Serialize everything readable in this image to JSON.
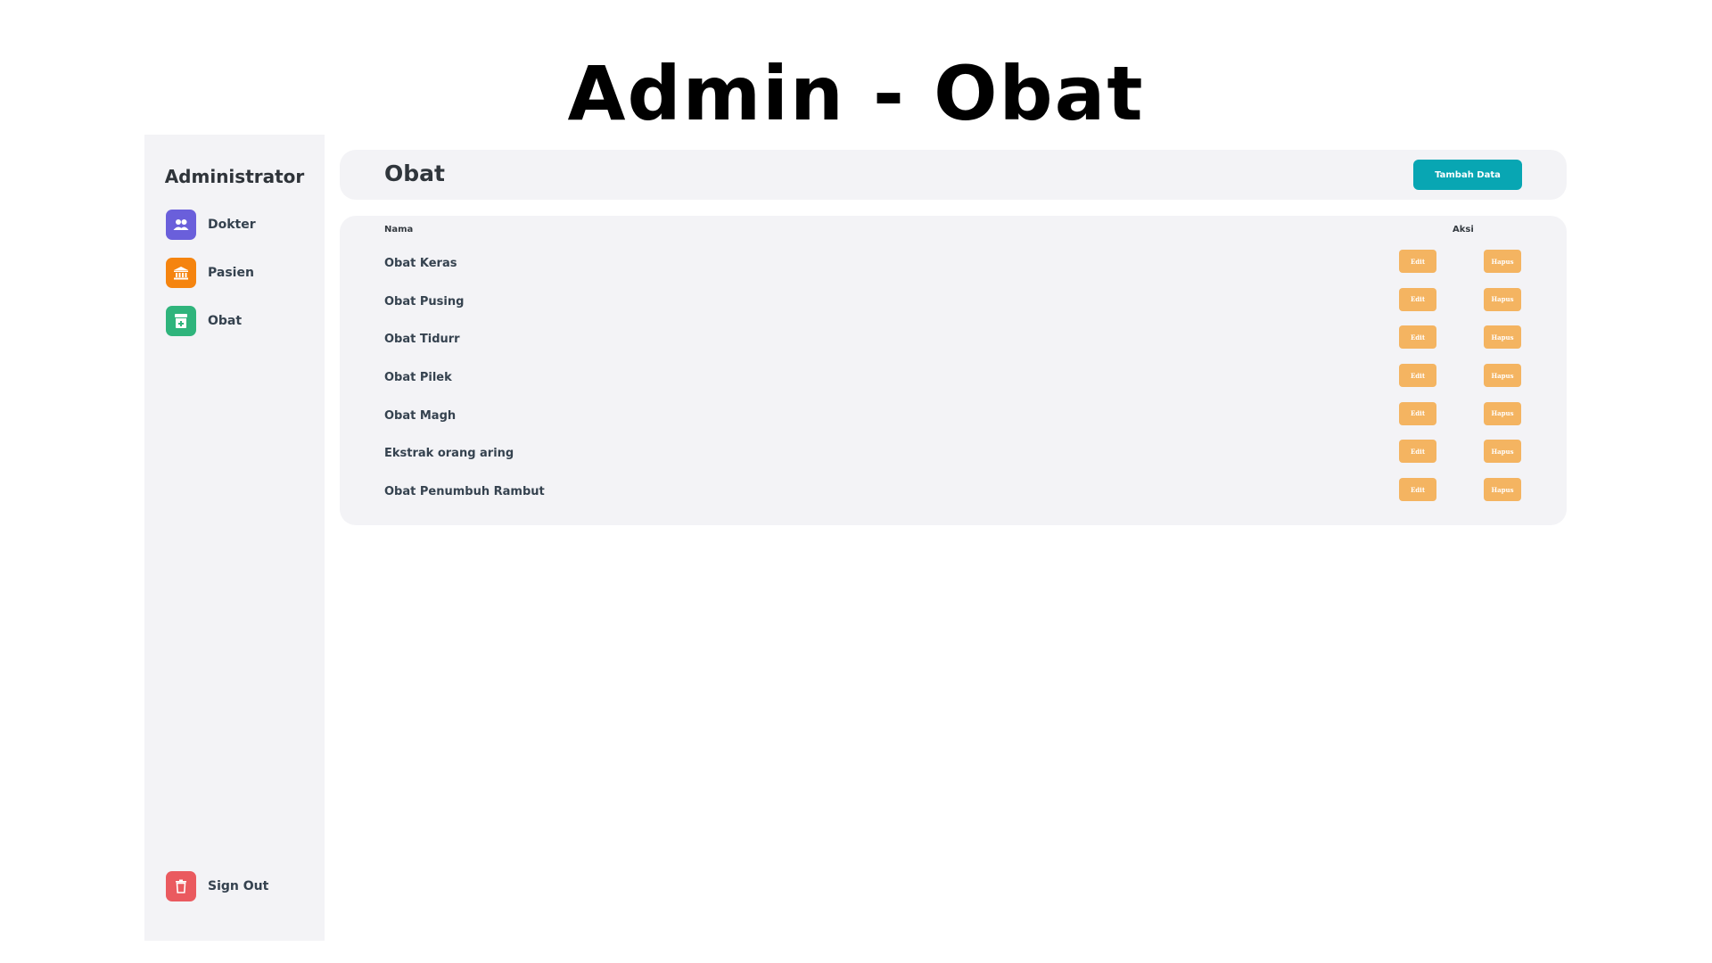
{
  "page": {
    "title": "Admin - Obat"
  },
  "sidebar": {
    "title": "Administrator",
    "items": [
      {
        "label": "Dokter",
        "icon": "users-icon",
        "color": "#6a5fdb"
      },
      {
        "label": "Pasien",
        "icon": "bank-icon",
        "color": "#f5840f"
      },
      {
        "label": "Obat",
        "icon": "medicine-icon",
        "color": "#2fb47c"
      }
    ],
    "signout": {
      "label": "Sign Out",
      "icon": "trash-icon",
      "color": "#ea5a5f"
    }
  },
  "header": {
    "title": "Obat",
    "add_button_label": "Tambah Data",
    "add_button_color": "#08a6b3"
  },
  "table": {
    "columns": {
      "name": "Nama",
      "action": "Aksi"
    },
    "edit_label": "Edit",
    "delete_label": "Hapus",
    "button_color": "#f4b461",
    "rows": [
      {
        "name": "Obat Keras"
      },
      {
        "name": "Obat Pusing"
      },
      {
        "name": "Obat Tidurr"
      },
      {
        "name": "Obat Pilek"
      },
      {
        "name": "Obat Magh"
      },
      {
        "name": "Ekstrak orang aring"
      },
      {
        "name": "Obat Penumbuh Rambut"
      }
    ]
  }
}
